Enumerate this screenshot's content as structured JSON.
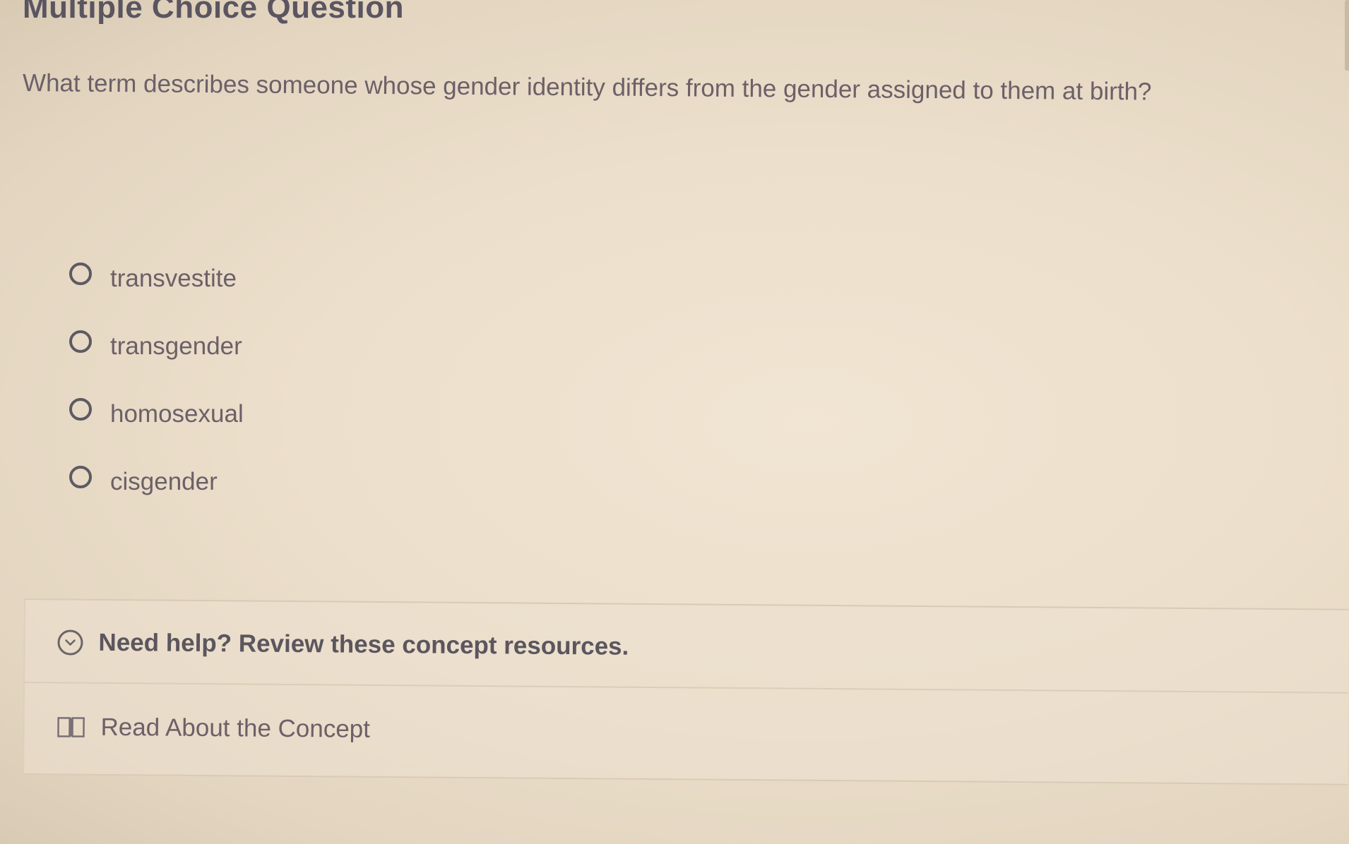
{
  "header": {
    "title": "Multiple Choice Question"
  },
  "question": {
    "text": "What term describes someone whose gender identity differs from the gender assigned to them at birth?"
  },
  "options": [
    {
      "label": "transvestite",
      "selected": false
    },
    {
      "label": "transgender",
      "selected": false
    },
    {
      "label": "homosexual",
      "selected": false
    },
    {
      "label": "cisgender",
      "selected": false
    }
  ],
  "help": {
    "toggle_label": "Need help? Review these concept resources.",
    "toggle_icon": "chevron-down-circle-icon",
    "resources": [
      {
        "label": "Read About the Concept",
        "icon": "book-icon"
      }
    ]
  },
  "colors": {
    "background": "#ecdfcb",
    "text": "#6c6068",
    "heading": "#5a5560"
  }
}
